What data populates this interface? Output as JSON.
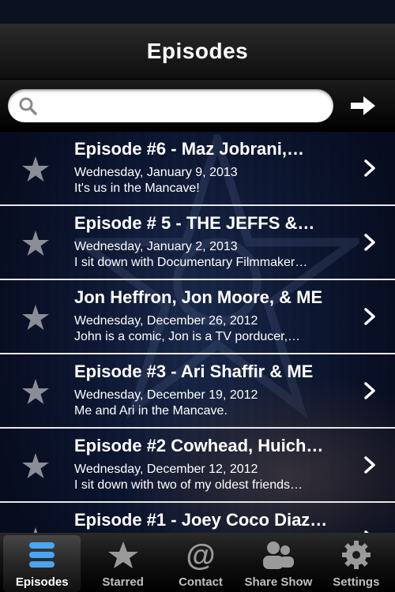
{
  "navbar": {
    "title": "Episodes"
  },
  "search": {
    "value": "",
    "placeholder": ""
  },
  "episodes": [
    {
      "title": "Episode #6 - Maz Jobrani,…",
      "date": "Wednesday, January 9, 2013",
      "desc": "It's us in the Mancave!"
    },
    {
      "title": "Episode # 5 - THE JEFFS &…",
      "date": "Wednesday, January 2, 2013",
      "desc": "I sit down with Documentary Filmmaker…"
    },
    {
      "title": "Jon Heffron, Jon Moore, & ME",
      "date": "Wednesday, December 26, 2012",
      "desc": "John is a comic, Jon is a TV porducer,…"
    },
    {
      "title": "Episode #3 - Ari Shaffir & ME",
      "date": "Wednesday, December 19, 2012",
      "desc": "Me and Ari in the Mancave."
    },
    {
      "title": "Episode #2 Cowhead, Huich…",
      "date": "Wednesday, December 12, 2012",
      "desc": "I sit down with two of my oldest friends…"
    },
    {
      "title": "Episode #1 - Joey Coco Diaz…",
      "date": "",
      "desc": ""
    }
  ],
  "tabs": [
    {
      "label": "Episodes",
      "icon": "list-icon"
    },
    {
      "label": "Starred",
      "icon": "star-icon"
    },
    {
      "label": "Contact",
      "icon": "at-icon"
    },
    {
      "label": "Share Show",
      "icon": "people-icon"
    },
    {
      "label": "Settings",
      "icon": "gear-icon"
    }
  ],
  "colors": {
    "selected_tab_icon": "#4aa6f0",
    "tab_icon": "#9a9a9a",
    "star": "#8a8d96"
  }
}
